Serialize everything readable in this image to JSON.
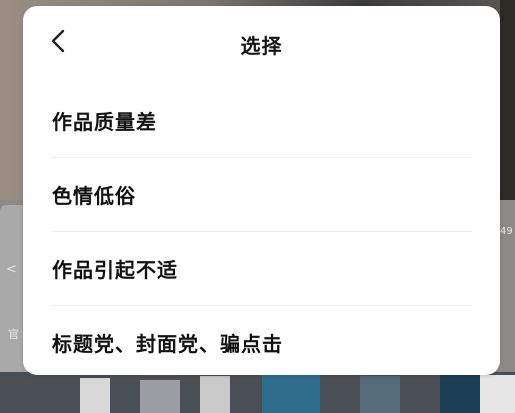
{
  "dialog": {
    "title": "选择",
    "back_icon": "chevron-left-icon"
  },
  "options": [
    {
      "label": "作品质量差"
    },
    {
      "label": "色情低俗"
    },
    {
      "label": "作品引起不适"
    },
    {
      "label": "标题党、封面党、骗点击"
    }
  ],
  "background": {
    "left_text_1": "官",
    "left_text_2": "<",
    "right_text": "49"
  }
}
